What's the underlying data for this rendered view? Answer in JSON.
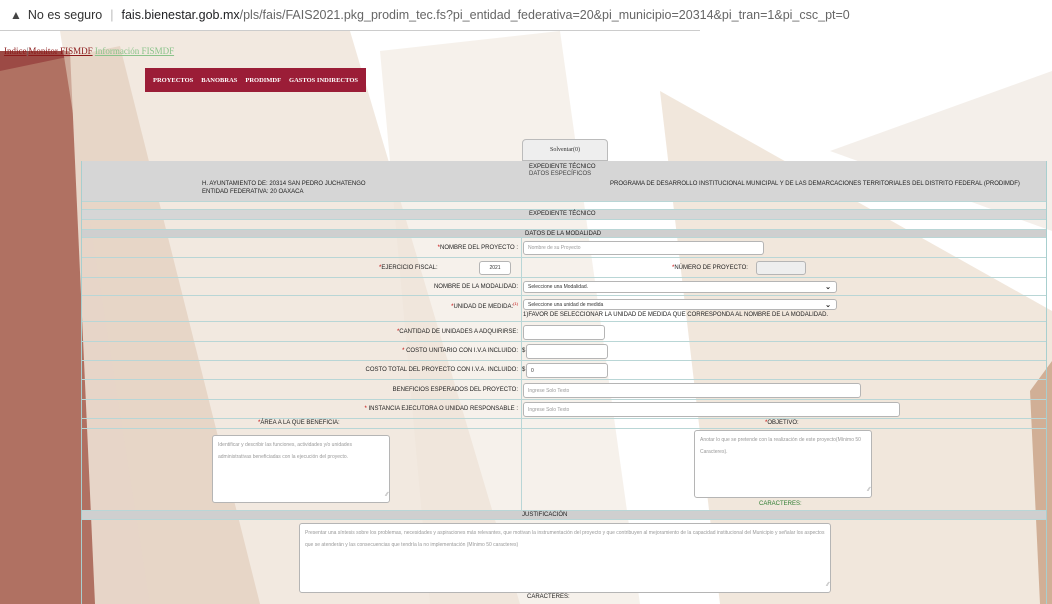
{
  "browser": {
    "warning": "No es seguro",
    "url_domain": "fais.bienestar.gob.mx",
    "url_path": "/pls/fais/FAIS2021.pkg_prodim_tec.fs?pi_entidad_federativa=20&pi_municipio=20314&pi_tran=1&pi_csc_pt=0"
  },
  "breadcrumb": {
    "indice": "Indice",
    "sep": "|",
    "monitor": "Monitor FISMDF",
    "info": "Información FISMDF"
  },
  "menu": [
    "PROYECTOS",
    "BANOBRAS",
    "PRODIMDF",
    "GASTOS INDIRECTOS"
  ],
  "solventar": "Solventar(0)",
  "header": {
    "exp_title": "EXPEDIENTE TÉCNICO",
    "exp_sub": "DATOS ESPECÍFICOS",
    "ayuntamiento": "H. AYUNTAMIENTO DE:  20314 SAN PEDRO JUCHATENGO",
    "entidad": "ENTIDAD FEDERATIVA:  20 OAXACA",
    "programa": "PROGRAMA DE DESARROLLO INSTITUCIONAL MUNICIPAL Y DE LAS DEMARCACIONES TERRITORIALES DEL DISTRITO FEDERAL (PRODIMDF)"
  },
  "sections": {
    "expediente": "EXPEDIENTE TÉCNICO",
    "modalidad": "DATOS DE LA MODALIDAD",
    "justificacion": "JUSTIFICACIÓN"
  },
  "fields": {
    "nombre_label": "NOMBRE DEL PROYECTO :",
    "nombre_placeholder": "Nombre de su Proyecto",
    "ejercicio_label": "EJERCICIO FISCAL:",
    "ejercicio_value": "2021",
    "numero_label": "NÚMERO DE PROYECTO:",
    "modalidad_label": "NOMBRE DE LA MODALIDAD:",
    "modalidad_value": "Seleccione una Modalidad.",
    "unidad_label": "UNIDAD DE MEDIDA:",
    "unidad_sup": "(1)",
    "unidad_value": "Seleccione una unidad de medida",
    "unidad_note": "1)FAVOR DE SELECCIONAR LA UNIDAD DE MEDIDA QUE CORRESPONDA AL NOMBRE DE LA MODALIDAD.",
    "cantidad_label": "CANTIDAD DE UNIDADES A ADQUIRIRSE:",
    "costo_unit_label": " COSTO UNITARIO CON I.V.A INCLUIDO:",
    "costo_total_label": "COSTO TOTAL DEL PROYECTO CON I.V.A. INCLUIDO:",
    "currency": "$",
    "costo_total_value": "0",
    "beneficios_label": "BENEFICIOS ESPERADOS DEL PROYECTO:",
    "beneficios_placeholder": "Ingrese Solo Texto",
    "instancia_label": " INSTANCIA EJECUTORA O UNIDAD RESPONSABLE :",
    "instancia_placeholder": "Ingrese Solo Texto",
    "area_label": "ÁREA A LA QUE BENEFICIA:",
    "area_placeholder": "Identificar y describir las funciones, actividades y/o unidades administrativas beneficiadas con la ejecución del proyecto.",
    "objetivo_label": "OBJETIVO:",
    "objetivo_placeholder": "Anotar lo que se pretende con la realización de este proyecto(Mínimo 50 Caracteres).",
    "caracteres_label": "CARACTERES:",
    "justificacion_placeholder": "Presentar una síntesis sobre los problemas, necesidades y aspiraciones más relevantes, que motivan la instrumentación del proyecto y que contribuyen al mejoramiento de la capacidad institucional del Municipio y señalar los aspectos que se atenderán y las consecuencias que tendría la no implementación (Mínimo 50 caracteres)",
    "required_mark": "*"
  },
  "colors": {
    "menu_bg": "#9b1d37",
    "required": "#c00000",
    "section_bar": "#d6d6d6",
    "objetivo_count": "#2e7d32"
  }
}
